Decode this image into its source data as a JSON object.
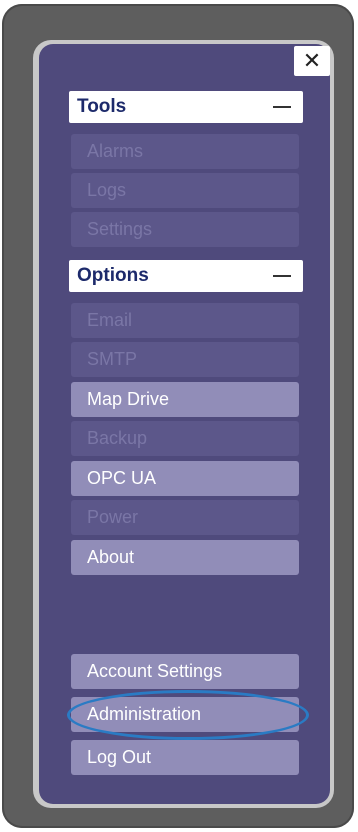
{
  "close": {
    "label": "✕"
  },
  "sections": {
    "tools": {
      "title": "Tools",
      "toggle": "—",
      "items": [
        "Alarms",
        "Logs",
        "Settings"
      ]
    },
    "options": {
      "title": "Options",
      "toggle": "—",
      "items": [
        "Email",
        "SMTP",
        "Map Drive",
        "Backup",
        "OPC UA",
        "Power",
        "About"
      ]
    }
  },
  "bottom": {
    "items": [
      "Account Settings",
      "Administration",
      "Log Out"
    ]
  },
  "colors": {
    "panel": "#4f4a7c",
    "enabled_item": "#918db8",
    "disabled_item": "#5c578a",
    "highlight": "#2a7bc4"
  }
}
